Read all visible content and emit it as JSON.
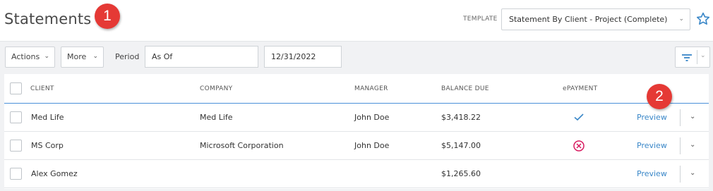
{
  "header": {
    "title": "Statements",
    "badge1": "1",
    "template_label": "TEMPLATE",
    "template_value": "Statement By Client - Project (Complete)",
    "favorite_icon": "star-icon"
  },
  "toolbar": {
    "actions_label": "Actions",
    "more_label": "More",
    "period_label": "Period",
    "period_value": "As Of",
    "date_value": "12/31/2022",
    "filter_icon": "filter-icon"
  },
  "table": {
    "columns": {
      "client": "CLIENT",
      "company": "COMPANY",
      "manager": "MANAGER",
      "balance": "BALANCE DUE",
      "epayment": "ePAYMENT"
    },
    "badge2": "2",
    "rows": [
      {
        "client": "Med Life",
        "company": "Med Life",
        "manager": "John Doe",
        "balance": "$3,418.22",
        "epayment": "check-icon",
        "preview": "Preview"
      },
      {
        "client": "MS Corp",
        "company": "Microsoft Corporation",
        "manager": "John Doe",
        "balance": "$5,147.00",
        "epayment": "x-circle-icon",
        "preview": "Preview"
      },
      {
        "client": "Alex Gomez",
        "company": "",
        "manager": "",
        "balance": "$1,265.60",
        "epayment": "",
        "preview": "Preview"
      }
    ]
  },
  "colors": {
    "accent": "#3a87c8",
    "badge": "#e53935",
    "error": "#d81b60",
    "toolbar_bg": "#f1f2f4"
  }
}
